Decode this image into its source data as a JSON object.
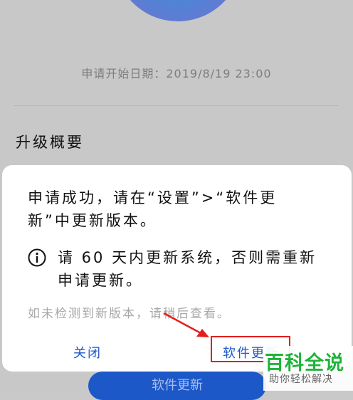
{
  "background": {
    "apply_date": "申请开始日期：2019/8/19 23:00",
    "summary_title": "升级概要",
    "bottom_button_label": "软件更新"
  },
  "dialog": {
    "message": "申请成功，请在“设置”>“软件更新”中更新版本。",
    "info_text": "请 60 天内更新系统，否则需重新申请更新。",
    "hint": "如未检测到新版本，请稍后查看。",
    "close_label": "关闭",
    "update_label": "软件更新"
  },
  "watermark": {
    "main": "百科全说",
    "sub": "助你轻松解决"
  },
  "colors": {
    "accent": "#1d58c8",
    "annotation": "#e02020",
    "watermark": "#1fb33a"
  }
}
